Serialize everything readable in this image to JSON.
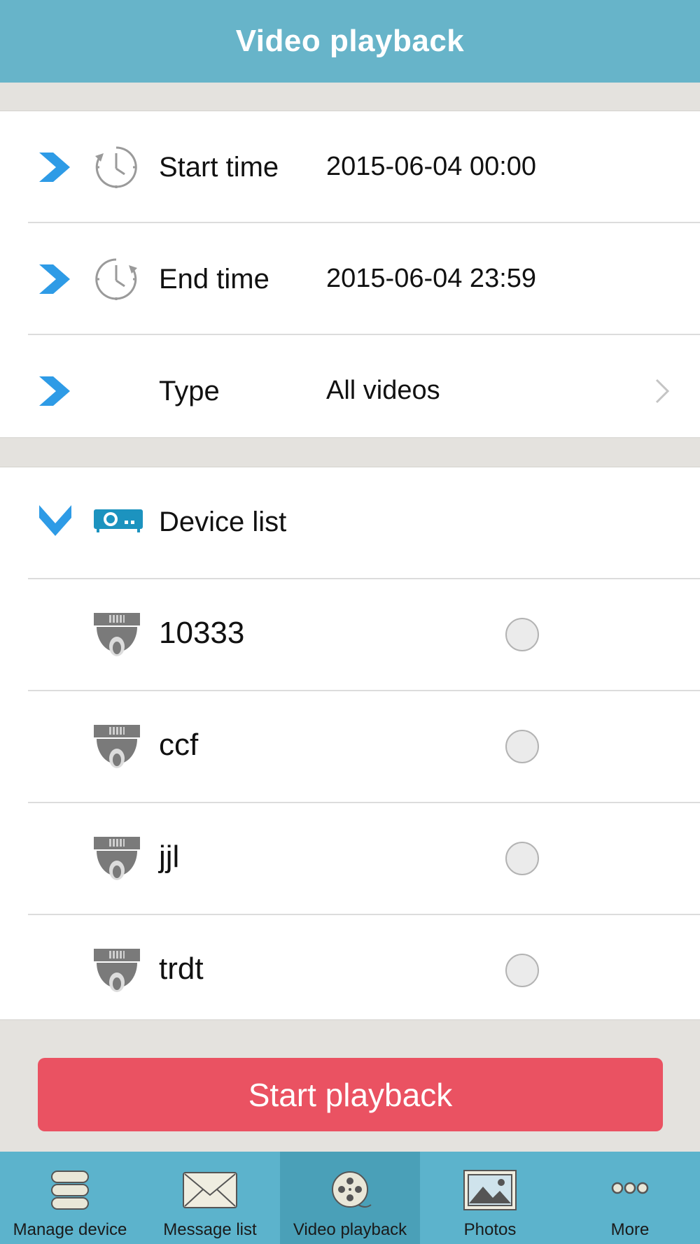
{
  "header": {
    "title": "Video playback"
  },
  "filters": {
    "start_time": {
      "label": "Start time",
      "value": "2015-06-04 00:00"
    },
    "end_time": {
      "label": "End time",
      "value": "2015-06-04 23:59"
    },
    "type": {
      "label": "Type",
      "value": "All videos"
    }
  },
  "devices": {
    "header_label": "Device list",
    "items": [
      {
        "name": "10333",
        "selected": false
      },
      {
        "name": "ccf",
        "selected": false
      },
      {
        "name": "jjl",
        "selected": false
      },
      {
        "name": "trdt",
        "selected": false
      }
    ]
  },
  "actions": {
    "start_playback": "Start playback"
  },
  "tabbar": {
    "tabs": [
      {
        "label": "Manage device",
        "icon": "database-icon",
        "active": false
      },
      {
        "label": "Message list",
        "icon": "envelope-icon",
        "active": false
      },
      {
        "label": "Video playback",
        "icon": "film-reel-icon",
        "active": true
      },
      {
        "label": "Photos",
        "icon": "picture-icon",
        "active": false
      },
      {
        "label": "More",
        "icon": "more-dots-icon",
        "active": false
      }
    ]
  },
  "colors": {
    "navbar": "#67b4c9",
    "tabbar": "#5cb3cc",
    "accent_arrow": "#2e9be6",
    "button": "#ea5262"
  }
}
